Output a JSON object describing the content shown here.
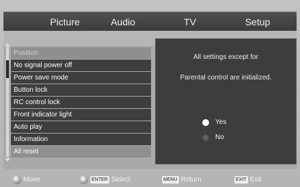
{
  "tabs": [
    {
      "label": "Picture"
    },
    {
      "label": "Audio"
    },
    {
      "label": "TV"
    },
    {
      "label": "Setup"
    }
  ],
  "menu": {
    "items": [
      {
        "label": "Position",
        "state": "dim"
      },
      {
        "label": "No signal power off",
        "state": "normal"
      },
      {
        "label": "Power save mode",
        "state": "normal"
      },
      {
        "label": "Button lock",
        "state": "normal"
      },
      {
        "label": "RC control lock",
        "state": "normal"
      },
      {
        "label": "Front indicator light",
        "state": "normal"
      },
      {
        "label": "Auto play",
        "state": "normal"
      },
      {
        "label": "Information",
        "state": "normal"
      },
      {
        "label": "All reset",
        "state": "selected"
      }
    ]
  },
  "dialog": {
    "line1": "All settings except for",
    "line2": "Parental control are initialized.",
    "options": [
      {
        "label": "Yes",
        "selected": true
      },
      {
        "label": "No",
        "selected": false
      }
    ]
  },
  "footer": {
    "move": "Move",
    "select_key": "ENTER",
    "select": "Select",
    "return_key": "MENU",
    "return": "Return",
    "exit_key": "EXIT",
    "exit": "Exit"
  }
}
